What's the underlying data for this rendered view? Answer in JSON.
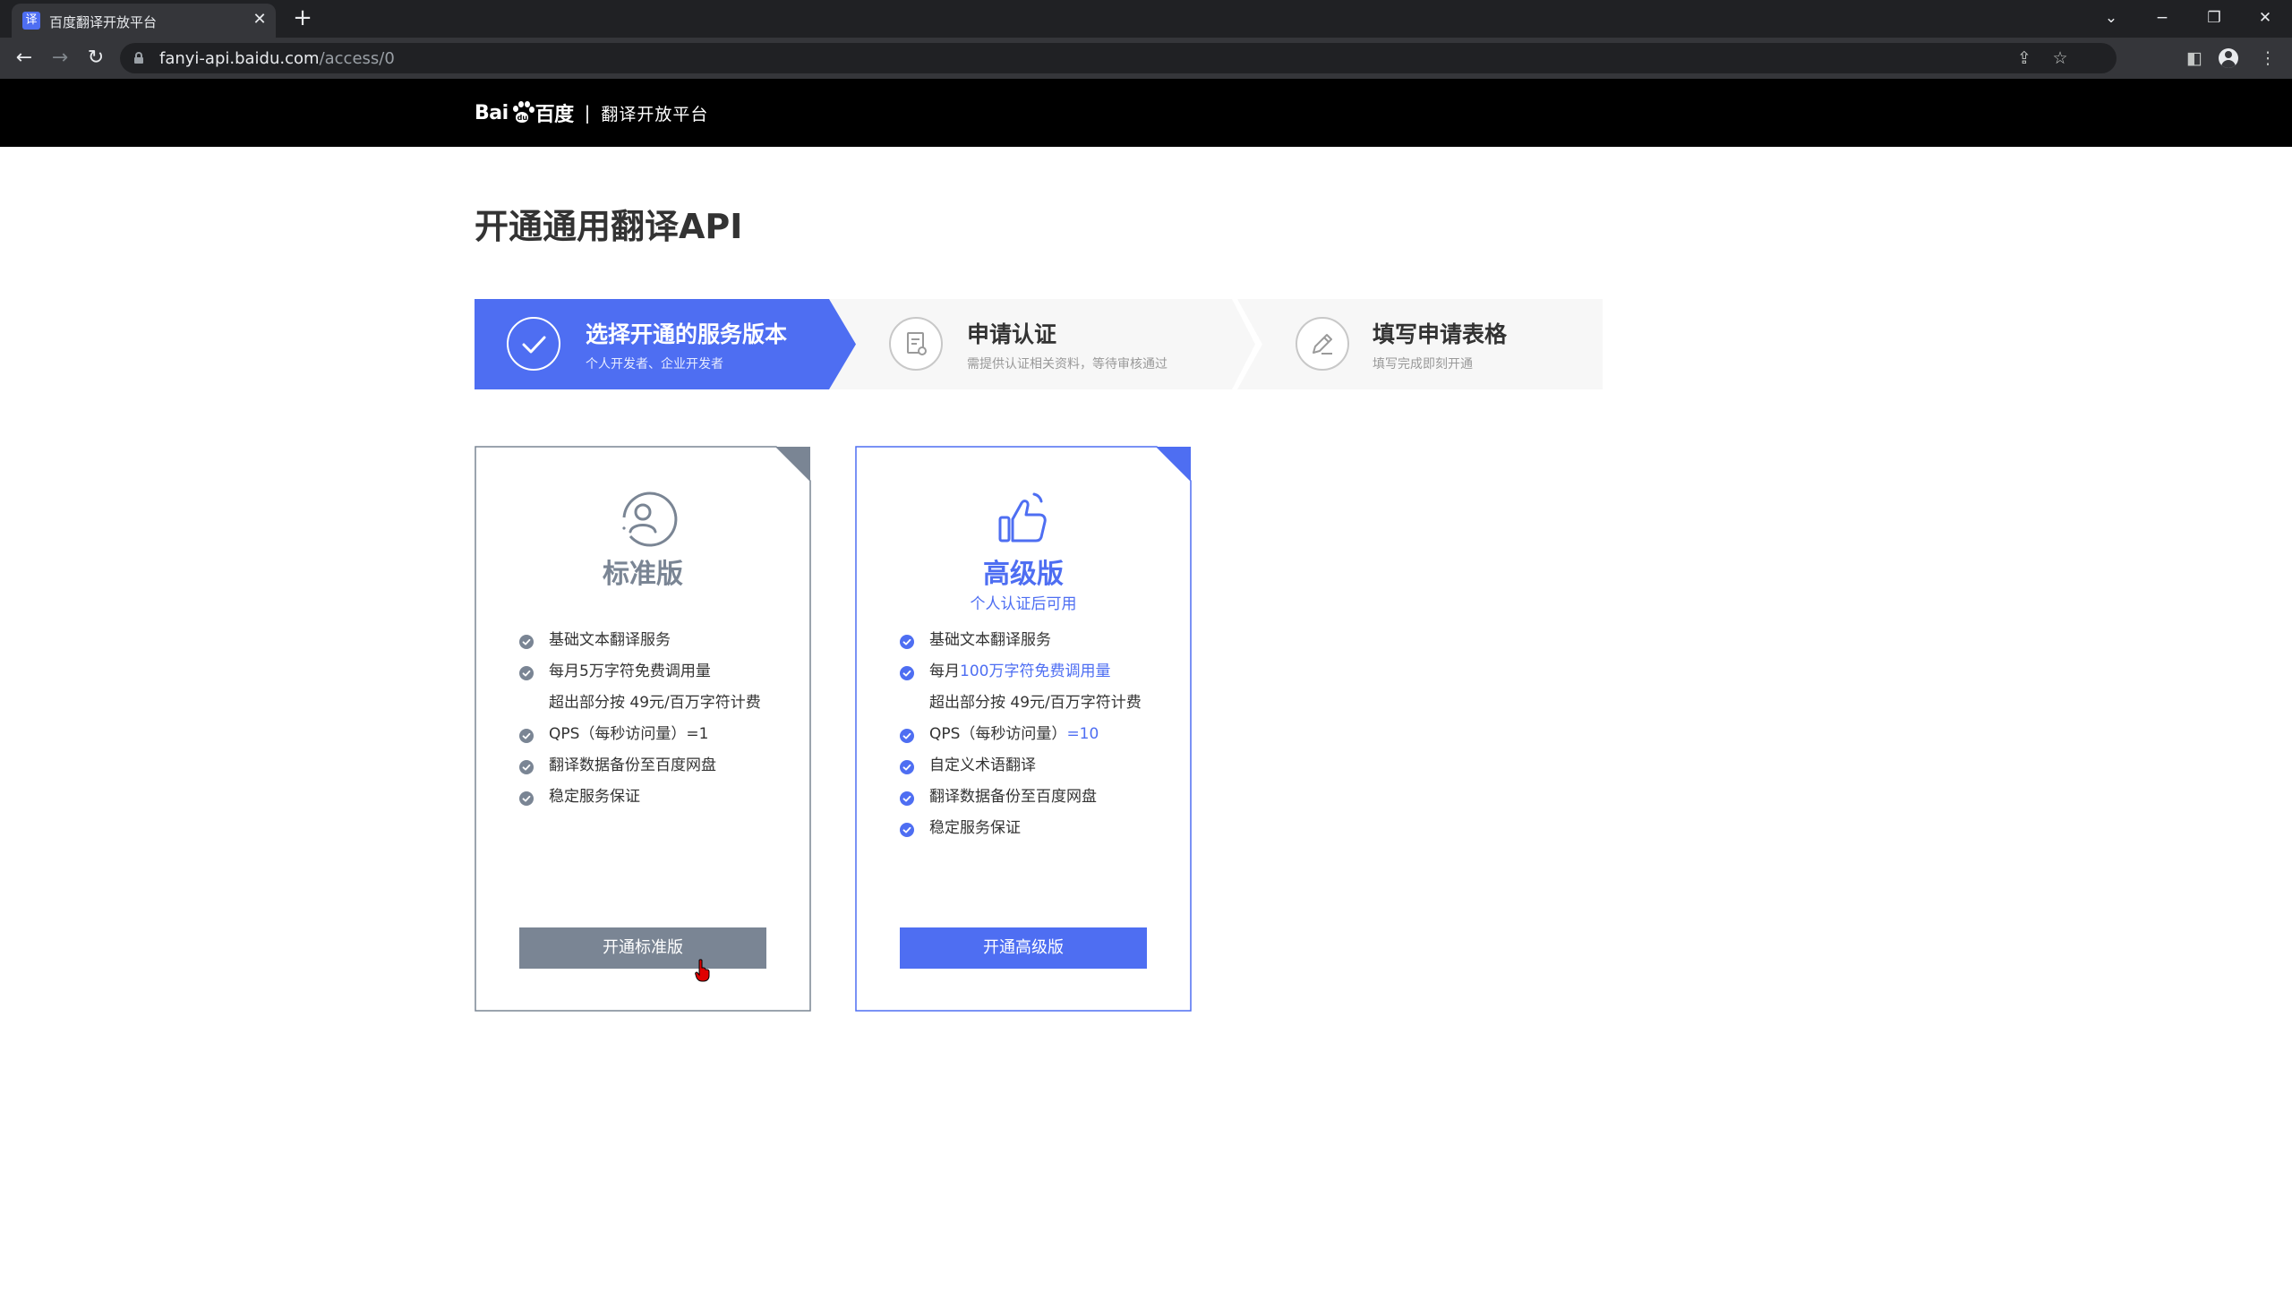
{
  "browser": {
    "tab_title": "百度翻译开放平台",
    "tab_favicon": "译",
    "close_glyph": "✕",
    "new_tab_glyph": "+",
    "url_host": "fanyi-api.baidu.com",
    "url_path": "/access/0",
    "icons": {
      "back": "arrow-left-icon",
      "forward": "arrow-right-icon",
      "reload": "reload-icon",
      "share": "share-icon",
      "bookmark": "star-icon",
      "sidepanel": "side-panel-icon",
      "profile": "avatar-icon",
      "menu": "kebab-menu-icon"
    }
  },
  "header": {
    "logo_left": "Bai",
    "logo_paw_text": "du",
    "logo_right": "百度",
    "separator": "|",
    "platform": "翻译开放平台"
  },
  "page": {
    "title": "开通通用翻译API"
  },
  "steps": [
    {
      "title": "选择开通的服务版本",
      "desc": "个人开发者、企业开发者",
      "active": true
    },
    {
      "title": "申请认证",
      "desc": "需提供认证相关资料，等待审核通过",
      "active": false
    },
    {
      "title": "填写申请表格",
      "desc": "填写完成即刻开通",
      "active": false
    }
  ],
  "cards": {
    "standard": {
      "name": "标准版",
      "features": [
        "基础文本翻译服务",
        "每月5万字符免费调用量",
        "超出部分按 49元/百万字符计费",
        "QPS（每秒访问量）=1",
        "翻译数据备份至百度网盘",
        "稳定服务保证"
      ],
      "button": "开通标准版"
    },
    "premium": {
      "name": "高级版",
      "subtitle": "个人认证后可用",
      "features": {
        "f1": "基础文本翻译服务",
        "f2_prefix": "每月",
        "f2_highlight": "100万字符免费调用量",
        "f3": "超出部分按 49元/百万字符计费",
        "f4_prefix": "QPS（每秒访问量）",
        "f4_highlight": "=10",
        "f5": "自定义术语翻译",
        "f6": "翻译数据备份至百度网盘",
        "f7": "稳定服务保证"
      },
      "button": "开通高级版"
    }
  },
  "colors": {
    "accent": "#4e6ef2",
    "standard_gray": "#7a8594",
    "header_bg": "#000000",
    "step_inactive_bg": "#f7f7f7"
  }
}
